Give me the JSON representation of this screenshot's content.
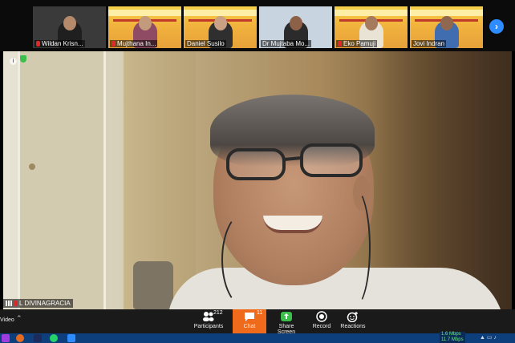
{
  "participants_strip": [
    {
      "name": "Wildan Krisn...",
      "muted": true,
      "bg": "#3a3a3a",
      "shirt": "#1f1f1f"
    },
    {
      "name": "Mujthana In...",
      "muted": true,
      "bg": "poster",
      "shirt": "#8e4b63"
    },
    {
      "name": "Daniel Susilo",
      "muted": false,
      "bg": "poster",
      "shirt": "#2f2f2f"
    },
    {
      "name": "Dr Mujtaba Mo...",
      "muted": false,
      "bg": "#c8d4e0",
      "shirt": "#2b2b2b"
    },
    {
      "name": "Eko Pamuji",
      "muted": true,
      "bg": "poster",
      "shirt": "#e8e3d4"
    },
    {
      "name": "Jovi Indran",
      "muted": false,
      "bg": "poster",
      "shirt": "#3f6db0"
    }
  ],
  "speaker": {
    "name": "L DIVINAGRACIA"
  },
  "toolbar": {
    "video_label": "Video",
    "participants_label": "Participants",
    "participants_count": "212",
    "chat_label": "Chat",
    "chat_count": "11",
    "share_label": "Share Screen",
    "record_label": "Record",
    "reactions_label": "Reactions"
  },
  "network": {
    "up": "1.6 Mbps",
    "down": "11.7 Mbps"
  },
  "colors": {
    "accent": "#2d8cff",
    "chat_active": "#f06a1b",
    "toolbar": "#1a1a1a",
    "share_green": "#3bbf4a"
  },
  "icons": [
    "chevron-right-icon",
    "info-icon",
    "shield-icon",
    "participants-icon",
    "chat-icon",
    "share-screen-icon",
    "record-icon",
    "reactions-icon"
  ]
}
